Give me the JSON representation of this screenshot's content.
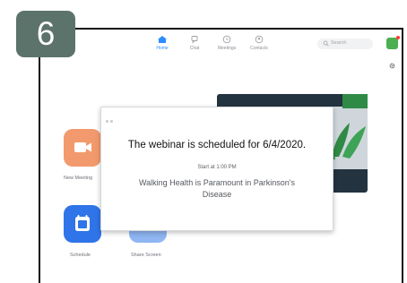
{
  "step_badge": {
    "label": "6"
  },
  "nav": {
    "items": [
      {
        "label": "Home",
        "icon": "home-icon",
        "active": true
      },
      {
        "label": "Chat",
        "icon": "chat-icon",
        "active": false
      },
      {
        "label": "Meetings",
        "icon": "clock-icon",
        "active": false
      },
      {
        "label": "Contacts",
        "icon": "contacts-icon",
        "active": false
      }
    ]
  },
  "search": {
    "placeholder": "Search"
  },
  "tiles": {
    "new_meeting": {
      "label": "New Meeting",
      "color": "#f29a6d",
      "icon": "video-camera-icon"
    },
    "schedule": {
      "label": "Schedule",
      "color": "#2f74e8",
      "icon": "calendar-icon"
    },
    "share_screen": {
      "label": "Share Screen",
      "color": "#2f74e8",
      "icon": "share-screen-icon"
    }
  },
  "popup": {
    "title": "The webinar is scheduled for 6/4/2020.",
    "start": "Start at 1:00 PM",
    "description": "Walking Health is Paramount in Parkinson's Disease"
  },
  "colors": {
    "badge": "#5c736c",
    "accent": "#2d8cff",
    "avatar": "#4caf50",
    "notification": "#ff3b30",
    "card_bg": "#243340",
    "plant": "#2f8a45"
  }
}
